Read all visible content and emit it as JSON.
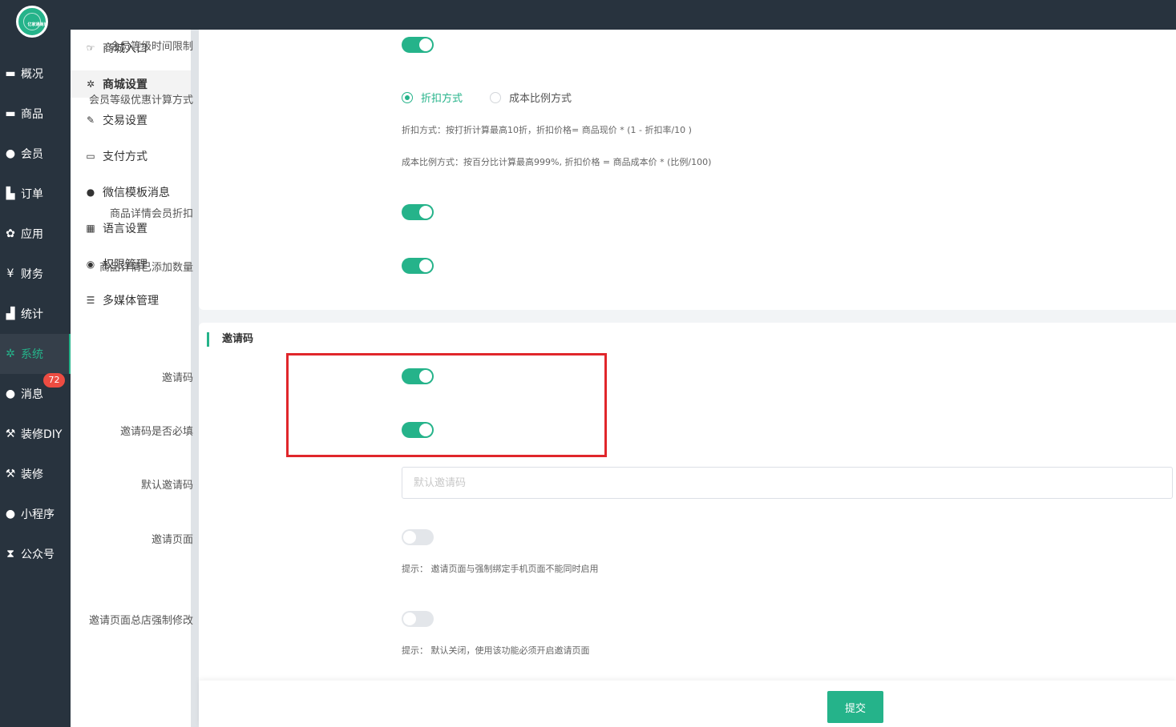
{
  "colors": {
    "accent": "#25b38a",
    "sidebar_bg": "#28333e",
    "badge": "#ed4c42",
    "highlight": "#e0262b"
  },
  "logo_text": "亿家通商城",
  "sidebar": {
    "items": [
      {
        "label": "概况",
        "icon": "overview-icon"
      },
      {
        "label": "商品",
        "icon": "goods-icon"
      },
      {
        "label": "会员",
        "icon": "members-icon"
      },
      {
        "label": "订单",
        "icon": "cart-icon"
      },
      {
        "label": "应用",
        "icon": "apps-icon"
      },
      {
        "label": "财务",
        "icon": "yen-icon"
      },
      {
        "label": "统计",
        "icon": "chart-icon"
      },
      {
        "label": "系统",
        "icon": "gear-icon",
        "active": true
      },
      {
        "label": "消息",
        "icon": "chat-icon"
      },
      {
        "label": "装修DIY",
        "icon": "hammer-icon"
      },
      {
        "label": "装修",
        "icon": "hammer-icon"
      },
      {
        "label": "小程序",
        "icon": "wechat-icon"
      },
      {
        "label": "公众号",
        "icon": "hourglass-icon"
      }
    ],
    "message_badge": "72"
  },
  "subnav": {
    "items": [
      {
        "label": "商城入口",
        "icon": "hand-pointer-icon"
      },
      {
        "label": "商城设置",
        "icon": "gear-icon",
        "active": true
      },
      {
        "label": "交易设置",
        "icon": "wrench-icon"
      },
      {
        "label": "支付方式",
        "icon": "credit-card-icon"
      },
      {
        "label": "微信模板消息",
        "icon": "wechat-icon"
      },
      {
        "label": "语言设置",
        "icon": "language-icon"
      },
      {
        "label": "权限管理",
        "icon": "mask-icon"
      },
      {
        "label": "多媒体管理",
        "icon": "list-icon"
      }
    ]
  },
  "settings": {
    "level_time_limit": {
      "label": "会员等级时间限制",
      "on": true
    },
    "discount_method": {
      "label": "会员等级优惠计算方式",
      "options": [
        "折扣方式",
        "成本比例方式"
      ],
      "selected": "折扣方式",
      "hint_discount": "折扣方式：按打折计算最高10折，折扣价格= 商品现价 * (1 - 折扣率/10 )",
      "hint_cost": "成本比例方式：按百分比计算最高999%, 折扣价格 = 商品成本价 * (比例/100)"
    },
    "detail_member_discount": {
      "label": "商品详情会员折扣",
      "on": true
    },
    "detail_added_count": {
      "label": "商品详情已添加数量",
      "on": true
    }
  },
  "invite": {
    "section_title": "邀请码",
    "invite_code": {
      "label": "邀请码",
      "on": true
    },
    "invite_required": {
      "label": "邀请码是否必填",
      "on": true
    },
    "default_code": {
      "label": "默认邀请码",
      "placeholder": "默认邀请码",
      "value": ""
    },
    "invite_page": {
      "label": "邀请页面",
      "on": false,
      "hint": "提示：  邀请页面与强制绑定手机页面不能同时启用"
    },
    "force_modify": {
      "label": "邀请页面总店强制修改",
      "on": false,
      "hint": "提示：  默认关闭，使用该功能必须开启邀请页面"
    }
  },
  "footer": {
    "submit_label": "提交"
  }
}
